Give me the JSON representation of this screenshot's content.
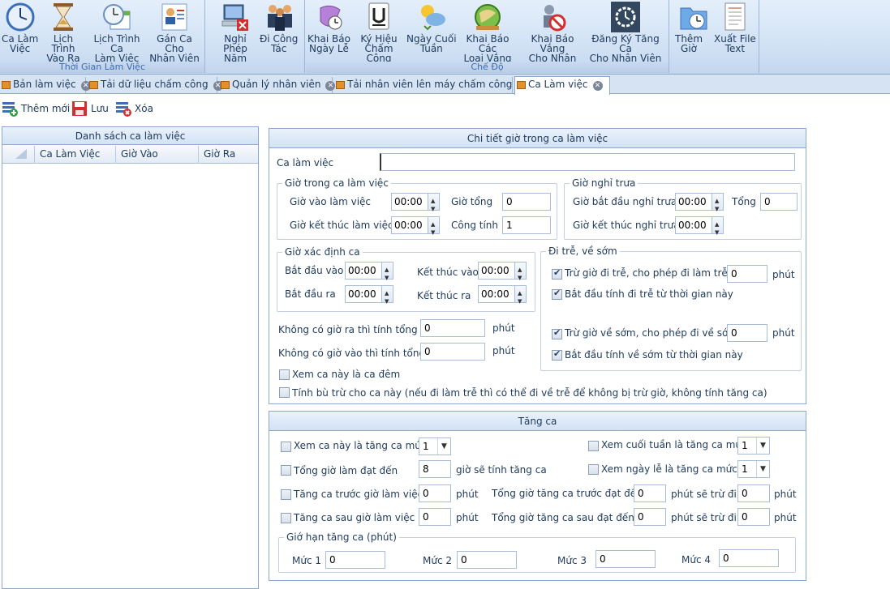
{
  "ribbon": {
    "groups": [
      {
        "title": "Thời Gian Làm Việc",
        "buttons": [
          {
            "label": "Ca Làm\nViệc",
            "icon": "clock-icon"
          },
          {
            "label": "Lịch Trình\nVào Ra",
            "icon": "hourglass-icon"
          },
          {
            "label": "Lịch Trình Ca\nLàm Việc",
            "icon": "calendar-clock-icon"
          },
          {
            "label": "Gán Ca Cho\nNhân Viên",
            "icon": "user-card-icon"
          }
        ]
      },
      {
        "title": "",
        "buttons": [
          {
            "label": "Nghỉ Phép\nNăm",
            "icon": "computer-x-icon"
          },
          {
            "label": "Đi Công\nTác",
            "icon": "people-icon"
          }
        ]
      },
      {
        "title": "Chế Độ",
        "buttons": [
          {
            "label": "Khai Báo\nNgày Lễ",
            "icon": "holiday-icon"
          },
          {
            "label": "Ký Hiệu\nChấm Công",
            "icon": "u-symbol-icon"
          },
          {
            "label": "Ngày Cuối\nTuần",
            "icon": "weather-icon"
          },
          {
            "label": "Khai Báo Các\nLoại Vắng",
            "icon": "globe-icon"
          },
          {
            "label": "Khai Báo Vắng\nCho Nhân Viên",
            "icon": "person-ban-icon"
          },
          {
            "label": "Đăng Ký Tăng Ca\nCho Nhân Viên",
            "icon": "gear-clock-icon"
          }
        ]
      },
      {
        "title": "",
        "buttons": [
          {
            "label": "Thêm\nGiờ",
            "icon": "folder-clock-icon"
          },
          {
            "label": "Xuất File\nText",
            "icon": "text-file-icon"
          }
        ]
      }
    ]
  },
  "tabs": [
    {
      "label": "Bản làm việc"
    },
    {
      "label": "Tải dữ liệu chấm công"
    },
    {
      "label": "Quản lý nhân viên"
    },
    {
      "label": "Tải nhân viên lên máy chấm công"
    },
    {
      "label": "Ca Làm việc"
    }
  ],
  "toolbar": {
    "add_label": "Thêm mới",
    "save_label": "Lưu",
    "delete_label": "Xóa"
  },
  "list_panel": {
    "title": "Danh sách ca làm việc",
    "columns": [
      "Ca Làm Việc",
      "Giờ Vào",
      "Giờ Ra"
    ]
  },
  "detail": {
    "title": "Chi tiết giờ trong ca làm việc",
    "shift_label": "Ca làm việc",
    "shift_value": "",
    "work_hours": {
      "legend": "Giờ trong ca làm việc",
      "start_label": "Giờ vào làm việc",
      "start_value": "00:00",
      "end_label": "Giờ kết thúc làm việc",
      "end_value": "00:00",
      "total_label": "Giờ tổng",
      "total_value": "0",
      "work_label": "Công tính",
      "work_value": "1"
    },
    "lunch": {
      "legend": "Giờ nghỉ trưa",
      "start_label": "Giờ bắt đầu nghỉ trưa",
      "start_value": "00:00",
      "end_label": "Giờ kết thúc nghỉ trưa",
      "end_value": "00:00",
      "total_label": "Tổng",
      "total_value": "0"
    },
    "shift_detect": {
      "legend": "Giờ xác định ca",
      "in_start_label": "Bắt đầu vào",
      "in_start_value": "00:00",
      "in_end_label": "Kết thúc vào",
      "in_end_value": "00:00",
      "out_start_label": "Bắt đầu ra",
      "out_start_value": "00:00",
      "out_end_label": "Kết thúc ra",
      "out_end_value": "00:00"
    },
    "late_early": {
      "legend": "Đi trễ, về sớm",
      "late_label": "Trừ giờ đi trễ, cho phép đi làm trễ",
      "late_value": "0",
      "late_unit": "phút",
      "late_start_label": "Bắt đầu tính đi trễ từ thời gian này",
      "early_label": "Trừ giờ về sớm, cho phép đi về sớm",
      "early_value": "0",
      "early_unit": "phút",
      "early_start_label": "Bắt đầu tính về sớm từ thời gian này"
    },
    "no_out_label": "Không có giờ ra thì tính tổng",
    "no_out_value": "0",
    "no_out_unit": "phút",
    "no_in_label": "Không có giờ vào thì tính tổng",
    "no_in_value": "0",
    "no_in_unit": "phút",
    "night_label": "Xem ca này là ca đêm",
    "comp_label": "Tính bù trừ cho ca này (nếu đi làm trễ thì có thể đi về trễ để không bị trừ giờ, không tính tăng ca)"
  },
  "overtime": {
    "title": "Tăng ca",
    "shift_level_label": "Xem ca này là tăng ca mức",
    "shift_level_value": "1",
    "weekend_label": "Xem cuối tuần là tăng ca mức",
    "weekend_value": "1",
    "total_reach_label": "Tổng giờ làm đạt đến",
    "total_reach_value": "8",
    "total_reach_suffix": "giờ sẽ tính tăng ca",
    "holiday_label": "Xem ngày lễ là tăng ca mức",
    "holiday_value": "1",
    "before_label": "Tăng ca trước giờ làm việc",
    "before_value": "0",
    "before_unit": "phút",
    "before_total_label": "Tổng giờ tăng ca trước đạt đến",
    "before_total_value": "0",
    "before_deduct_label": "phút sẽ trừ đi",
    "before_deduct_value": "0",
    "before_deduct_unit": "phút",
    "after_label": "Tăng ca sau giờ làm việc",
    "after_value": "0",
    "after_unit": "phút",
    "after_total_label": "Tổng giờ tăng ca sau đạt đến",
    "after_total_value": "0",
    "after_deduct_label": "phút sẽ trừ đi",
    "after_deduct_value": "0",
    "after_deduct_unit": "phút",
    "limit_legend": "Giớ hạn tăng ca (phút)",
    "levels": [
      {
        "label": "Mức 1",
        "value": "0"
      },
      {
        "label": "Mức 2",
        "value": "0"
      },
      {
        "label": "Mức 3",
        "value": "0"
      },
      {
        "label": "Mức 4",
        "value": "0"
      }
    ]
  }
}
